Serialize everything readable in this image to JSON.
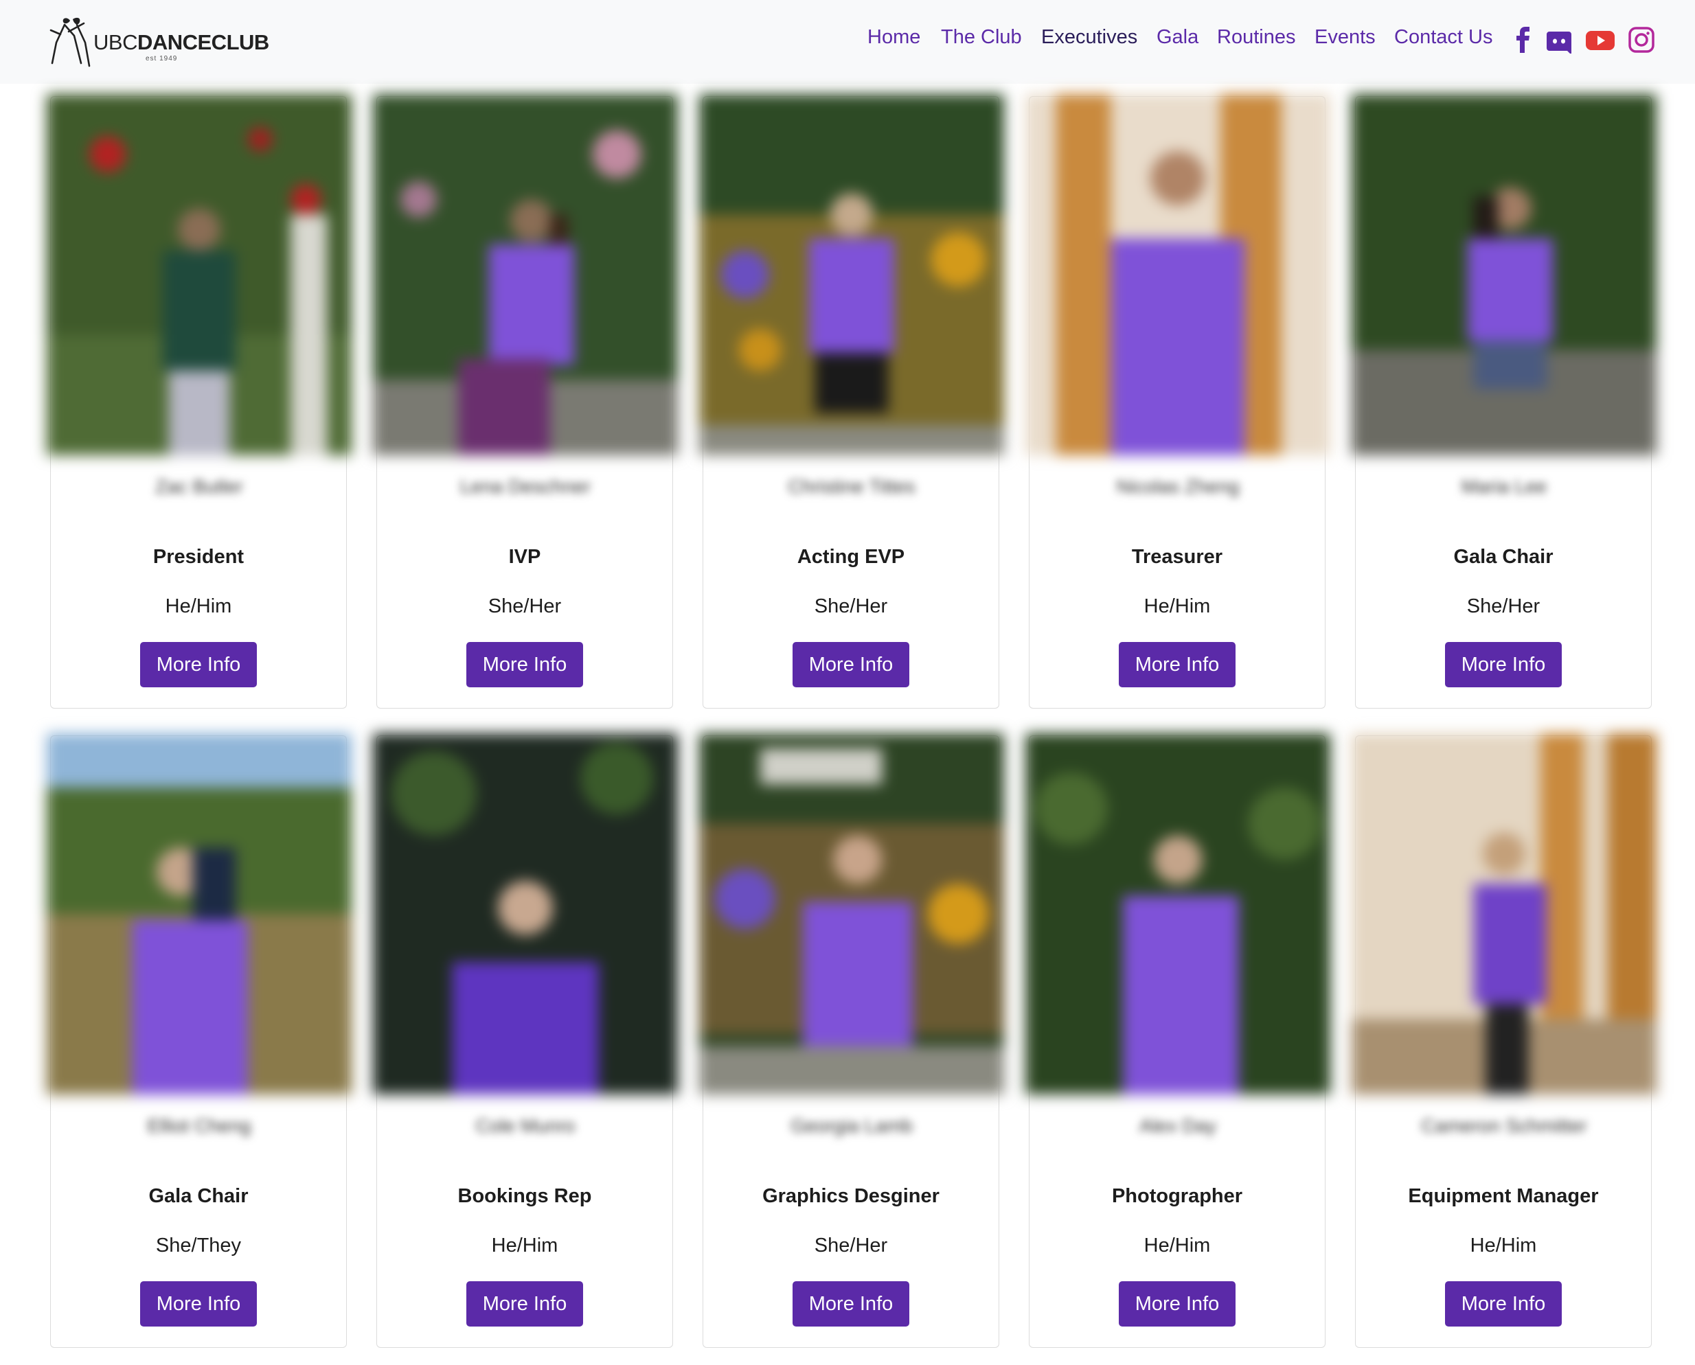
{
  "brand": {
    "name_part1": "UBC",
    "name_part2": "DANCECLUB",
    "established": "est 1949"
  },
  "nav": {
    "links": [
      {
        "label": "Home"
      },
      {
        "label": "The Club"
      },
      {
        "label": "Executives"
      },
      {
        "label": "Gala"
      },
      {
        "label": "Routines"
      },
      {
        "label": "Events"
      },
      {
        "label": "Contact Us"
      }
    ],
    "active": "Executives",
    "social_icons": [
      "facebook-icon",
      "discord-icon",
      "youtube-icon",
      "instagram-icon"
    ],
    "colors": {
      "link": "#5b2aa8",
      "active": "#2b1e5a",
      "youtube": "#e53935",
      "instagram": "#b3289b",
      "background": "#f8f9fa"
    }
  },
  "button_color": "#5b2aa8",
  "executives": [
    {
      "name": "Zac Butler",
      "role": "President",
      "pronouns": "He/Him",
      "button": "More Info"
    },
    {
      "name": "Lena Deschner",
      "role": "IVP",
      "pronouns": "She/Her",
      "button": "More Info"
    },
    {
      "name": "Christine Tittes",
      "role": "Acting EVP",
      "pronouns": "She/Her",
      "button": "More Info"
    },
    {
      "name": "Nicolas Zheng",
      "role": "Treasurer",
      "pronouns": "He/Him",
      "button": "More Info"
    },
    {
      "name": "Maria Lee",
      "role": "Gala Chair",
      "pronouns": "She/Her",
      "button": "More Info"
    },
    {
      "name": "Elliot Cheng",
      "role": "Gala Chair",
      "pronouns": "She/They",
      "button": "More Info"
    },
    {
      "name": "Cole Munro",
      "role": "Bookings Rep",
      "pronouns": "He/Him",
      "button": "More Info"
    },
    {
      "name": "Georgia Lamb",
      "role": "Graphics Desginer",
      "pronouns": "She/Her",
      "button": "More Info"
    },
    {
      "name": "Alex Day",
      "role": "Photographer",
      "pronouns": "He/Him",
      "button": "More Info"
    },
    {
      "name": "Cameron Schmitter",
      "role": "Equipment Manager",
      "pronouns": "He/Him",
      "button": "More Info"
    }
  ]
}
